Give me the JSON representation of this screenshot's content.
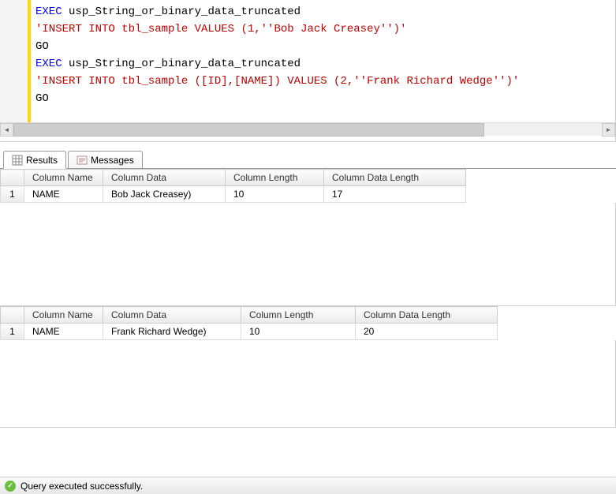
{
  "code": {
    "line1_kw": "EXEC",
    "line1_proc": " usp_String_or_binary_data_truncated",
    "line2": "'INSERT INTO tbl_sample VALUES (1,''Bob Jack Creasey'')'",
    "line3": "GO",
    "line4_kw": "EXEC",
    "line4_proc": " usp_String_or_binary_data_truncated",
    "line5": "'INSERT INTO tbl_sample ([ID],[NAME]) VALUES (2,''Frank Richard Wedge'')'",
    "line6": "GO"
  },
  "tabs": {
    "results": "Results",
    "messages": "Messages"
  },
  "grid1": {
    "headers": {
      "col_name": "Column Name",
      "col_data": "Column Data",
      "col_len": "Column Length",
      "col_dlen": "Column Data Length"
    },
    "rows": [
      {
        "idx": "1",
        "name": "NAME",
        "data": "Bob Jack Creasey)",
        "len": "10",
        "dlen": "17"
      }
    ]
  },
  "grid2": {
    "headers": {
      "col_name": "Column Name",
      "col_data": "Column Data",
      "col_len": "Column Length",
      "col_dlen": "Column Data Length"
    },
    "rows": [
      {
        "idx": "1",
        "name": "NAME",
        "data": "Frank Richard Wedge)",
        "len": "10",
        "dlen": "20"
      }
    ]
  },
  "status": {
    "message": "Query executed successfully."
  }
}
